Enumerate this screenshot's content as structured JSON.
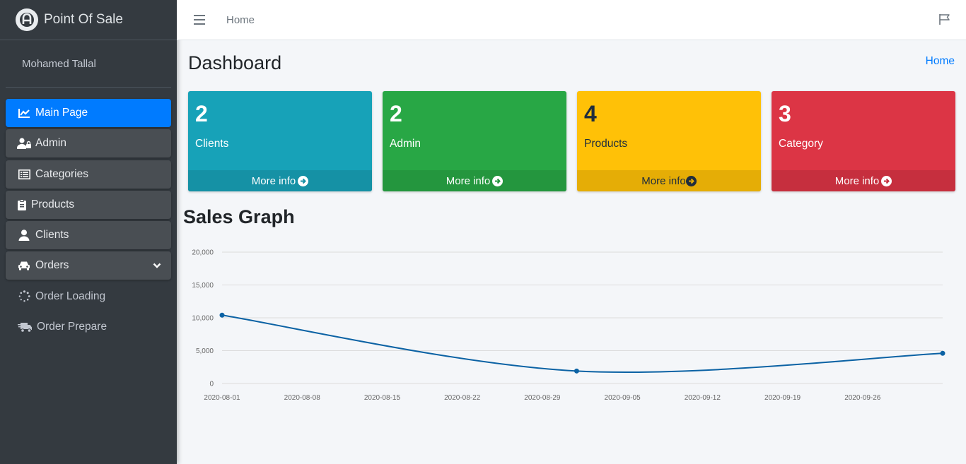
{
  "brand": {
    "name": "Point Of Sale",
    "logo_icon": "brand-logo-icon"
  },
  "user": {
    "name": "Mohamed Tallal"
  },
  "sidebar": {
    "items": [
      {
        "label": "Main Page",
        "icon": "chart-line-icon",
        "active": true
      },
      {
        "label": "Admin",
        "icon": "user-lock-icon"
      },
      {
        "label": "Categories",
        "icon": "list-icon"
      },
      {
        "label": "Products",
        "icon": "clipboard-icon"
      },
      {
        "label": "Clients",
        "icon": "user-icon"
      },
      {
        "label": "Orders",
        "icon": "car-icon",
        "has_submenu": true
      },
      {
        "label": "Order Loading",
        "icon": "spinner-icon"
      },
      {
        "label": "Order Prepare",
        "icon": "truck-icon"
      }
    ]
  },
  "topbar": {
    "home_link": "Home"
  },
  "page": {
    "title": "Dashboard",
    "breadcrumb": "Home"
  },
  "cards": [
    {
      "value": "2",
      "label": "Clients",
      "footer": "More info",
      "color": "#17a2b8"
    },
    {
      "value": "2",
      "label": "Admin",
      "footer": "More info",
      "color": "#28a745"
    },
    {
      "value": "4",
      "label": "Products",
      "footer": "More info",
      "color": "#ffc107"
    },
    {
      "value": "3",
      "label": "Category",
      "footer": "More info",
      "color": "#dc3545"
    }
  ],
  "sales": {
    "title": "Sales Graph"
  },
  "chart_data": {
    "type": "line",
    "title": "",
    "xlabel": "",
    "ylabel": "",
    "ylim": [
      0,
      20000
    ],
    "y_ticks": [
      "0",
      "5,000",
      "10,000",
      "15,000",
      "20,000"
    ],
    "x_ticks": [
      "2020-08-01",
      "2020-08-08",
      "2020-08-15",
      "2020-08-22",
      "2020-08-29",
      "2020-09-05",
      "2020-09-12",
      "2020-09-19",
      "2020-09-26"
    ],
    "xlim": [
      "2020-08-01",
      "2020-10-03"
    ],
    "series": [
      {
        "x": [
          "2020-08-01",
          "2020-09-01",
          "2020-10-03"
        ],
        "values": [
          10400,
          1900,
          4600
        ],
        "color": "#0b62a4"
      }
    ],
    "grid": true
  }
}
